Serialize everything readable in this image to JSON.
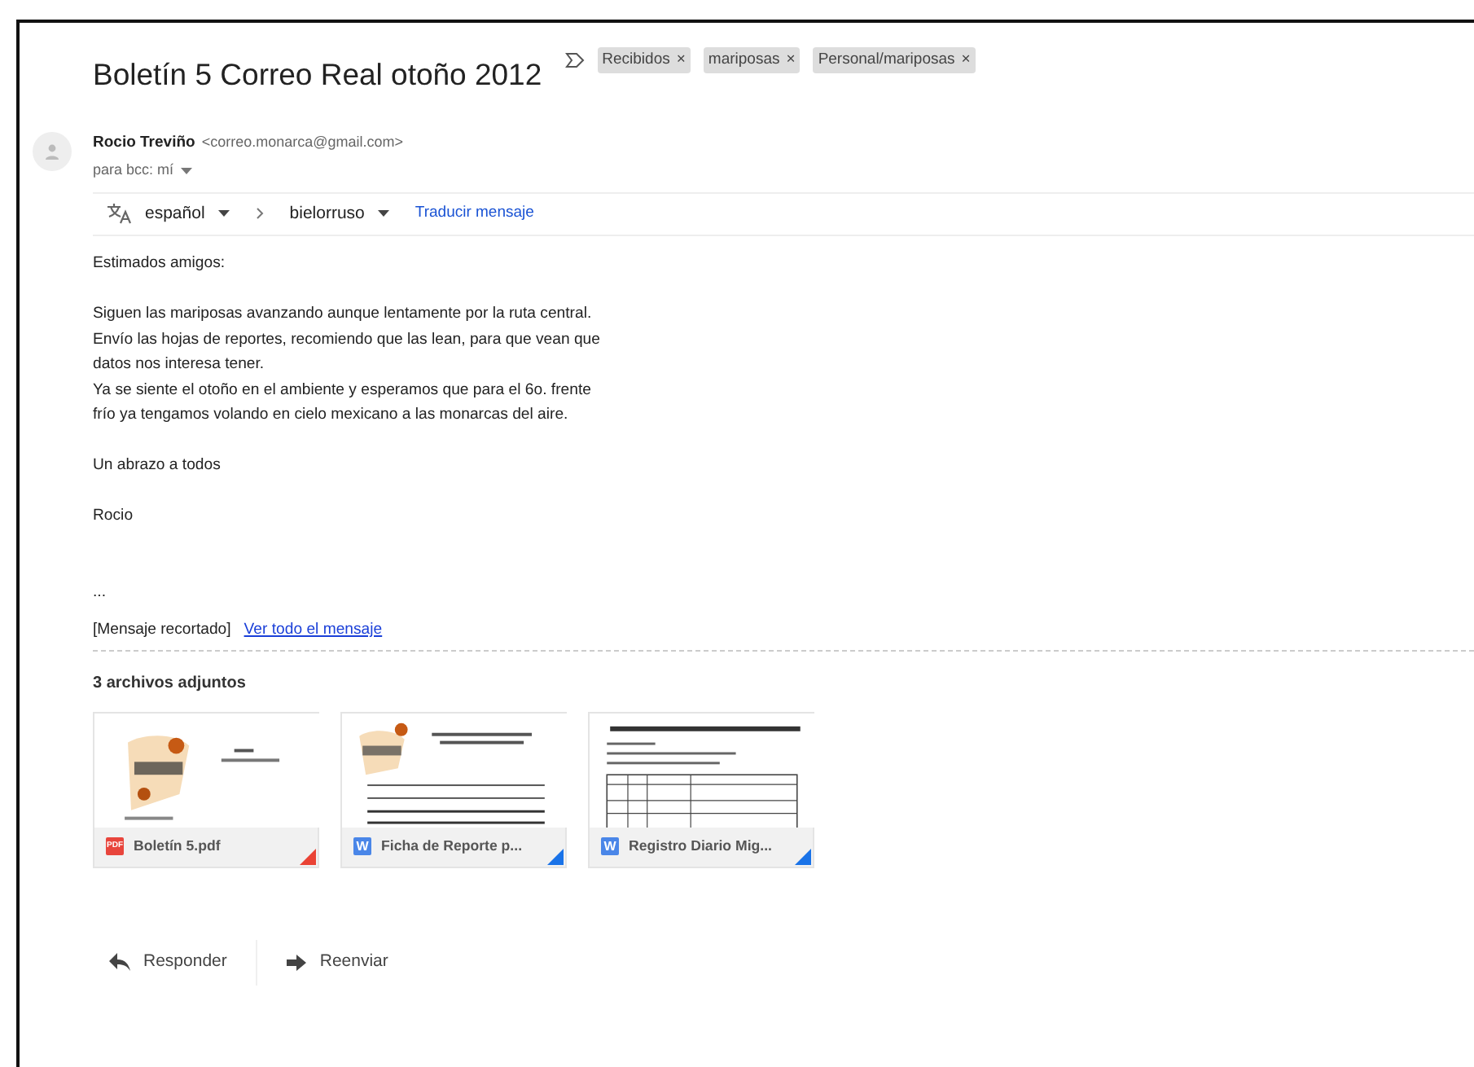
{
  "subject": "Boletín 5 Correo Real otoño 2012",
  "labels": [
    "Recibidos",
    "mariposas",
    "Personal/mariposas"
  ],
  "label_close": "×",
  "sender": {
    "name": "Rocio Treviño",
    "email": "<correo.monarca@gmail.com>",
    "recipients": "para bcc: mí"
  },
  "translate": {
    "from": "español",
    "to": "bielorruso",
    "action": "Traducir mensaje"
  },
  "body": [
    "Estimados amigos:",
    "Siguen las mariposas avanzando aunque lentamente por la ruta central.\nEnvío las hojas de reportes, recomiendo que las lean, para que vean que\ndatos nos interesa tener.\nYa se siente el otoño en el ambiente y esperamos que para el 6o. frente\nfrío ya tengamos volando en cielo mexicano a las monarcas del aire.",
    "Un abrazo a todos",
    "Rocio"
  ],
  "ellipsis": "...",
  "clipped": {
    "note": "[Mensaje recortado]",
    "link": "Ver todo el mensaje"
  },
  "attachments_title": "3 archivos adjuntos",
  "attachments": [
    {
      "kind": "pdf",
      "badge": "PDF",
      "name": "Boletín 5.pdf",
      "color": "#ea4335"
    },
    {
      "kind": "word",
      "badge": "W",
      "name": "Ficha de Reporte p...",
      "color": "#1a73e8"
    },
    {
      "kind": "word",
      "badge": "W",
      "name": "Registro Diario Mig...",
      "color": "#1a73e8"
    }
  ],
  "actions": [
    {
      "kind": "reply",
      "label": "Responder"
    },
    {
      "kind": "forward",
      "label": "Reenviar"
    }
  ]
}
